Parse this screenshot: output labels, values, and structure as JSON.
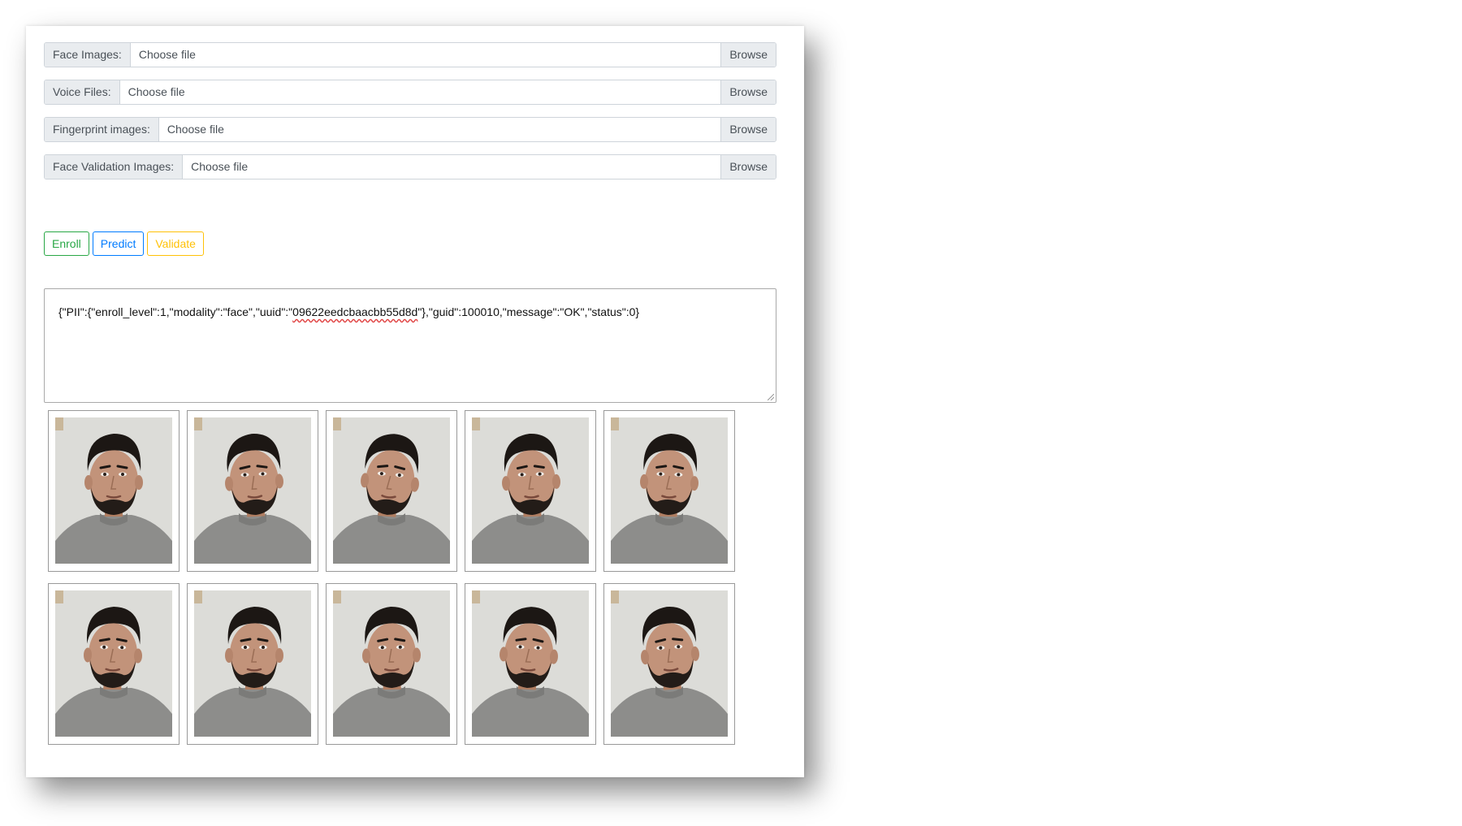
{
  "form": {
    "rows": [
      {
        "label": "Face Images:",
        "placeholder": "Choose file",
        "browse": "Browse"
      },
      {
        "label": "Voice Files:",
        "placeholder": "Choose file",
        "browse": "Browse"
      },
      {
        "label": "Fingerprint images:",
        "placeholder": "Choose file",
        "browse": "Browse"
      },
      {
        "label": "Face Validation Images:",
        "placeholder": "Choose file",
        "browse": "Browse"
      }
    ]
  },
  "actions": {
    "enroll": "Enroll",
    "predict": "Predict",
    "validate": "Validate"
  },
  "output": {
    "prefix": "{\"PII\":{\"enroll_level\":1,\"modality\":\"face\",\"uuid\":\"",
    "uuid": "09622eedcbaacbb55d8d",
    "suffix": "\"},\"guid\":100010,\"message\":\"OK\",\"status\":0}"
  },
  "colors": {
    "enroll": "#28a745",
    "predict": "#007bff",
    "validate": "#ffc107"
  }
}
